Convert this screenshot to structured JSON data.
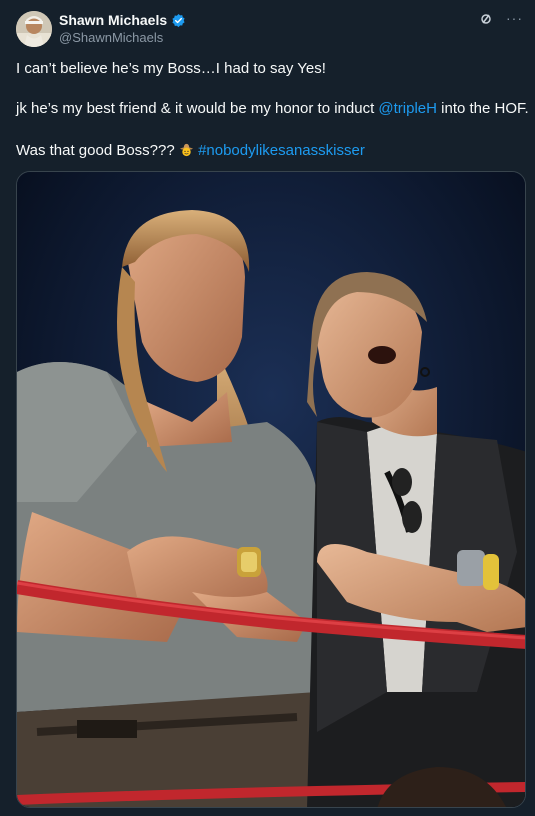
{
  "author": {
    "display_name": "Shawn Michaels",
    "handle": "@ShawnMichaels"
  },
  "tweet": {
    "line1": "I can’t believe he’s my Boss…I had to say Yes!",
    "line2_before": "jk he’s my best friend & it would be my honor to induct ",
    "line2_mention": "@tripleH",
    "line2_after": " into the HOF.",
    "line3_before": "Was that good Boss??? ",
    "line3_hashtag": "#nobodylikesanasskisser"
  },
  "icons": {
    "verified": "verified-badge-icon",
    "grok": "grok-icon",
    "more": "more-icon",
    "emoji": "cowboy-emoji-icon"
  },
  "colors": {
    "background": "#15202b",
    "link": "#1d9bf0",
    "secondary_text": "#8b98a5"
  }
}
